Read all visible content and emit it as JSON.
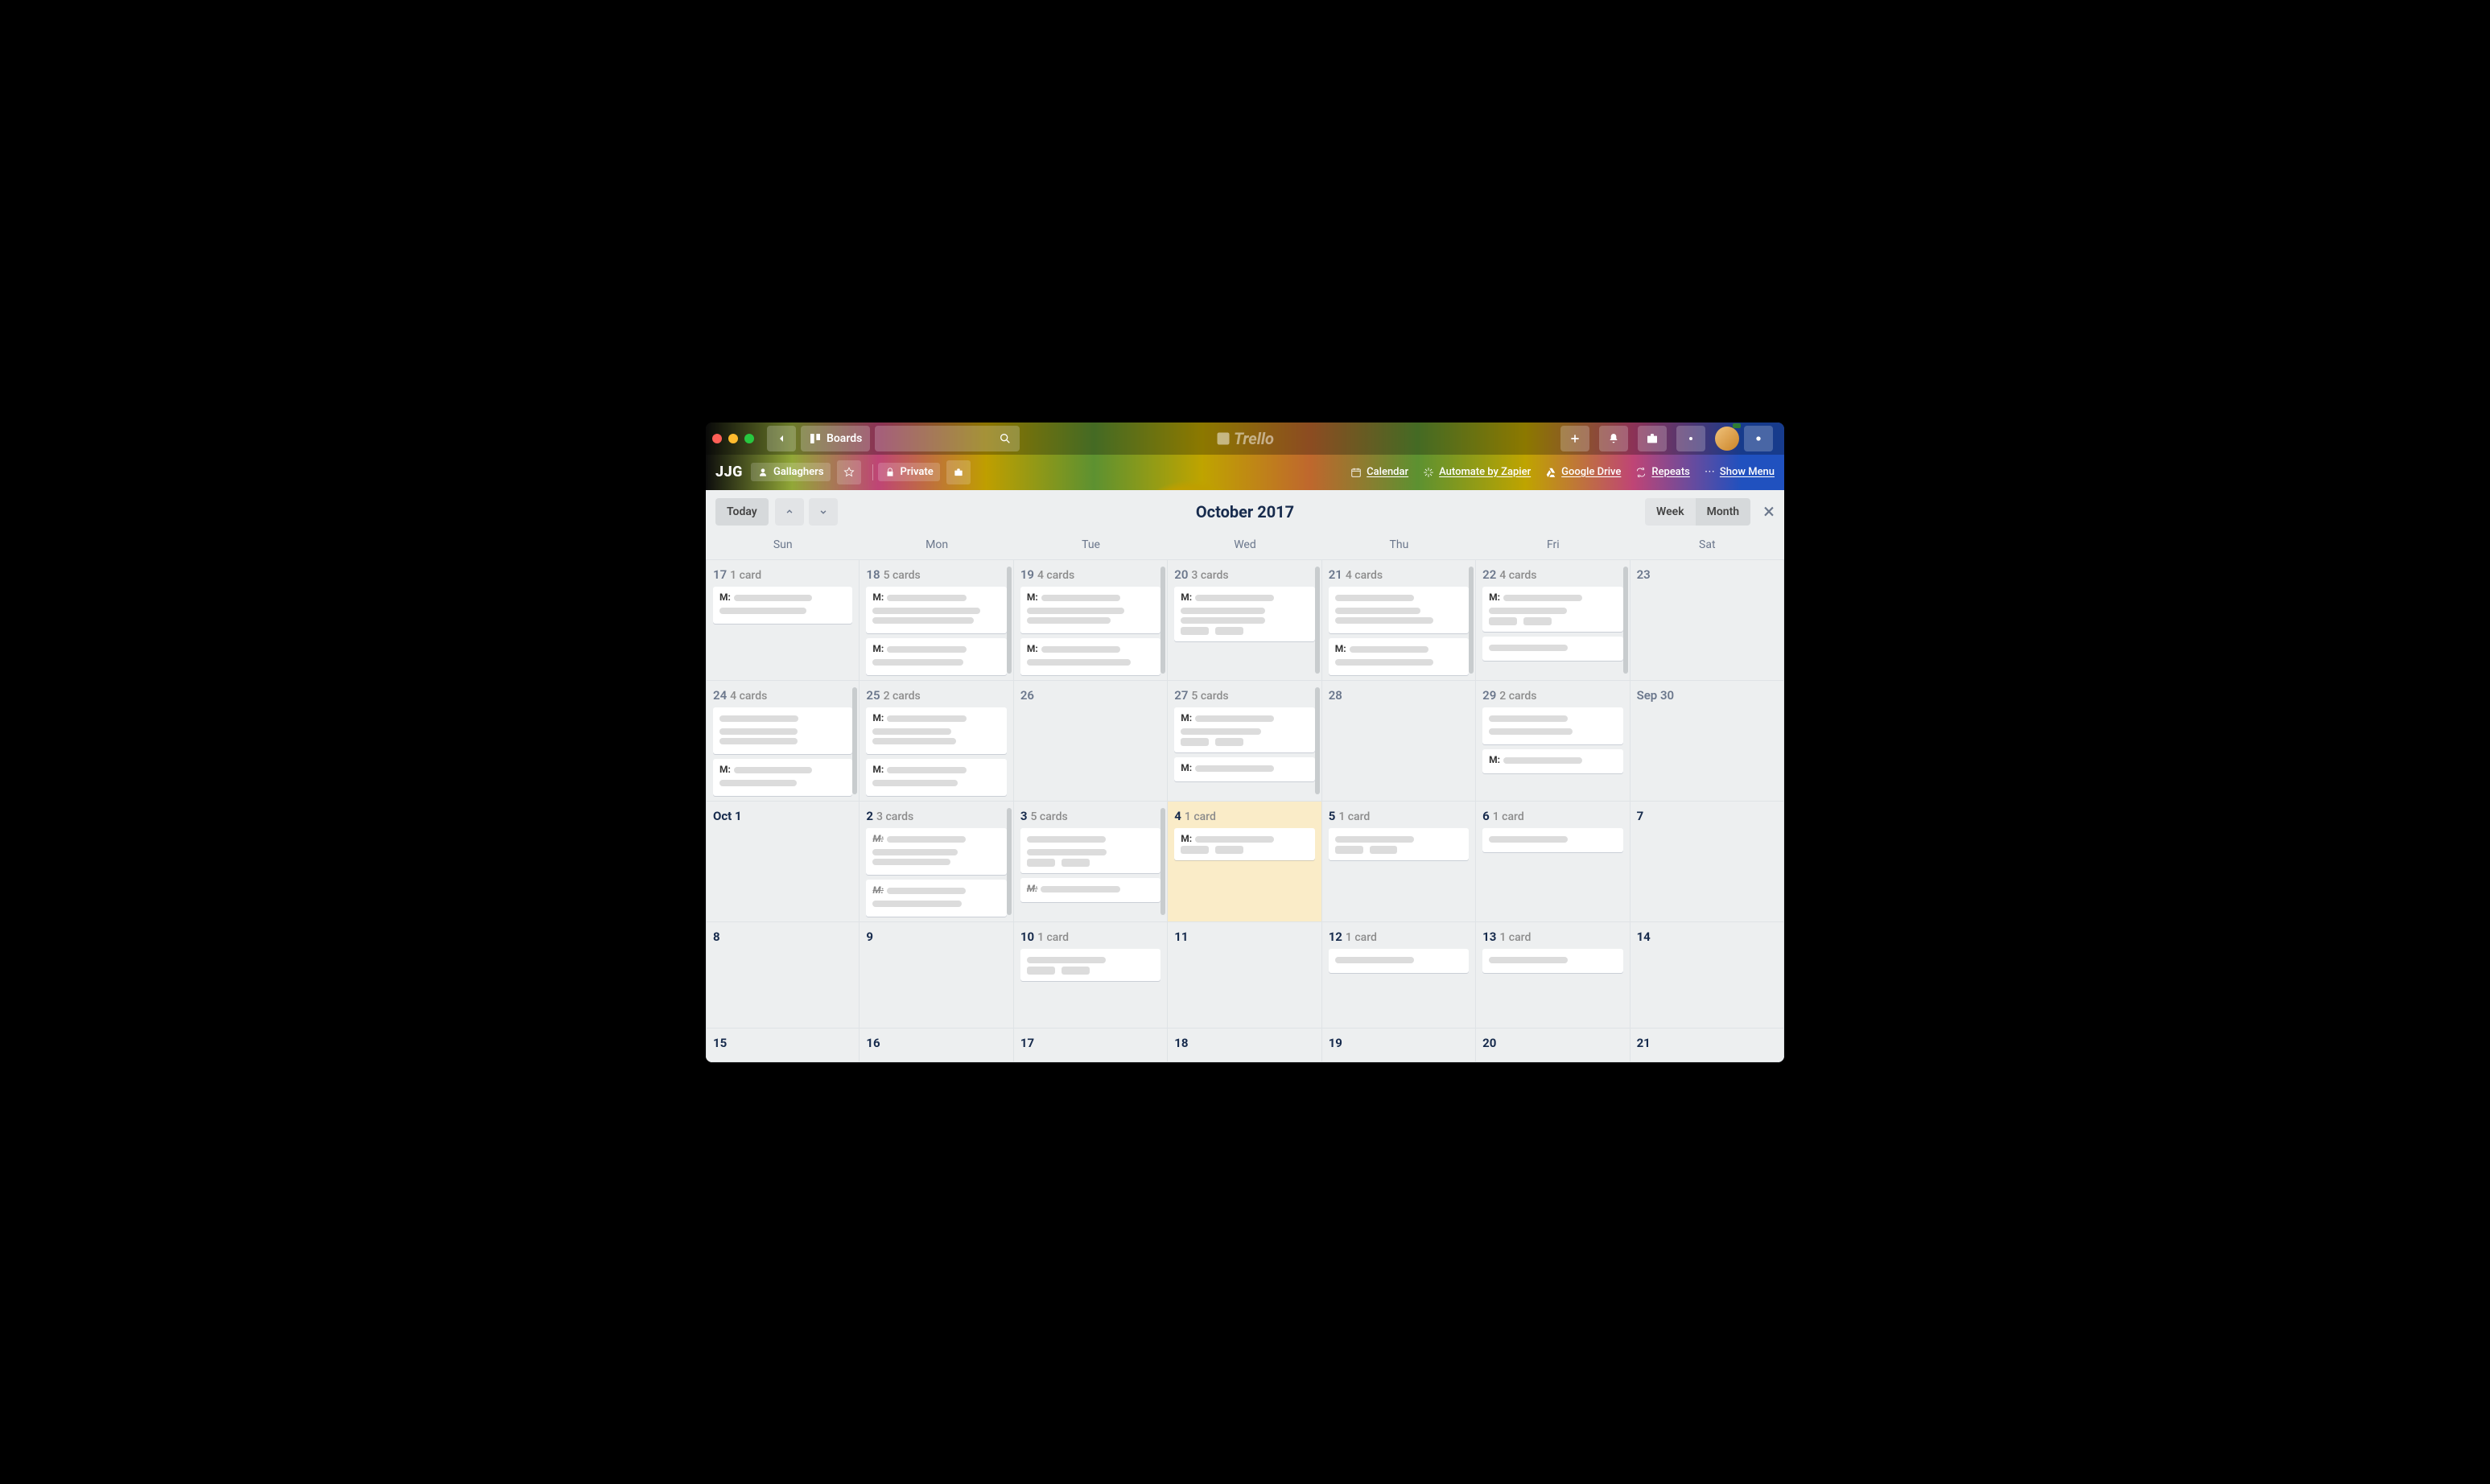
{
  "topbar": {
    "boards_label": "Boards",
    "logo_text": "Trello"
  },
  "board": {
    "title": "JJG",
    "team": "Gallaghers",
    "visibility": "Private",
    "powerups": [
      {
        "icon": "calendar",
        "label": "Calendar"
      },
      {
        "icon": "zap",
        "label": "Automate by Zapier"
      },
      {
        "icon": "gdrive",
        "label": "Google Drive"
      },
      {
        "icon": "repeat",
        "label": "Repeats"
      }
    ],
    "show_menu": "Show Menu"
  },
  "calendar": {
    "today_label": "Today",
    "title": "October 2017",
    "week_label": "Week",
    "month_label": "Month",
    "dow": [
      "Sun",
      "Mon",
      "Tue",
      "Wed",
      "Thu",
      "Fri",
      "Sat"
    ],
    "weeks": [
      [
        {
          "num": "17",
          "count": "1 card",
          "cards": [
            {
              "m": true
            }
          ],
          "dim": true
        },
        {
          "num": "18",
          "count": "5 cards",
          "cards": [
            {
              "m": true,
              "lines": 3
            },
            {
              "m": true
            }
          ],
          "dim": true,
          "scroll": true
        },
        {
          "num": "19",
          "count": "4 cards",
          "cards": [
            {
              "m": true,
              "lines": 3
            },
            {
              "m": true
            }
          ],
          "dim": true,
          "scroll": true
        },
        {
          "num": "20",
          "count": "3 cards",
          "cards": [
            {
              "m": true,
              "lines": 3,
              "badges": true
            }
          ],
          "dim": true,
          "scroll": true
        },
        {
          "num": "21",
          "count": "4 cards",
          "cards": [
            {
              "lines": 3
            },
            {
              "m": true
            }
          ],
          "dim": true,
          "scroll": true
        },
        {
          "num": "22",
          "count": "4 cards",
          "cards": [
            {
              "m": true,
              "lines": 2,
              "badges": true
            },
            {
              "lines": 1
            }
          ],
          "dim": true,
          "scroll": true
        },
        {
          "num": "23",
          "count": "",
          "cards": [],
          "dim": true
        }
      ],
      [
        {
          "num": "24",
          "count": "4 cards",
          "cards": [
            {
              "lines": 3
            },
            {
              "m": true
            }
          ],
          "dim": true,
          "scroll": true
        },
        {
          "num": "25",
          "count": "2 cards",
          "cards": [
            {
              "m": true,
              "lines": 3
            },
            {
              "m": true
            }
          ],
          "dim": true
        },
        {
          "num": "26",
          "count": "",
          "cards": [],
          "dim": true
        },
        {
          "num": "27",
          "count": "5 cards",
          "cards": [
            {
              "m": true,
              "lines": 2,
              "badges": true
            },
            {
              "m": true,
              "lines": 1
            }
          ],
          "dim": true,
          "scroll": true
        },
        {
          "num": "28",
          "count": "",
          "cards": [],
          "dim": true
        },
        {
          "num": "29",
          "count": "2 cards",
          "cards": [
            {
              "lines": 2
            },
            {
              "m": true,
              "lines": 1
            }
          ],
          "dim": true
        },
        {
          "num": "Sep 30",
          "count": "",
          "cards": [],
          "dim": true
        }
      ],
      [
        {
          "num": "Oct 1",
          "count": "",
          "cards": []
        },
        {
          "num": "2",
          "count": "3 cards",
          "cards": [
            {
              "m": true,
              "done": true,
              "lines": 3
            },
            {
              "m": true,
              "done": true
            }
          ],
          "scroll": true
        },
        {
          "num": "3",
          "count": "5 cards",
          "cards": [
            {
              "lines": 2,
              "badges": true
            },
            {
              "m": true,
              "done": true,
              "lines": 1
            }
          ],
          "scroll": true
        },
        {
          "num": "4",
          "count": "1 card",
          "today": true,
          "cards": [
            {
              "m": true,
              "lines": 1,
              "badges": true
            }
          ]
        },
        {
          "num": "5",
          "count": "1 card",
          "cards": [
            {
              "lines": 1,
              "badges": true
            }
          ]
        },
        {
          "num": "6",
          "count": "1 card",
          "cards": [
            {
              "lines": 1
            }
          ]
        },
        {
          "num": "7",
          "count": "",
          "cards": []
        }
      ],
      [
        {
          "num": "8",
          "count": "",
          "cards": []
        },
        {
          "num": "9",
          "count": "",
          "cards": []
        },
        {
          "num": "10",
          "count": "1 card",
          "cards": [
            {
              "lines": 1,
              "badges": true
            }
          ]
        },
        {
          "num": "11",
          "count": "",
          "cards": []
        },
        {
          "num": "12",
          "count": "1 card",
          "cards": [
            {
              "lines": 1
            }
          ]
        },
        {
          "num": "13",
          "count": "1 card",
          "cards": [
            {
              "lines": 1
            }
          ]
        },
        {
          "num": "14",
          "count": "",
          "cards": []
        }
      ],
      [
        {
          "num": "15",
          "count": "",
          "cards": [],
          "short": true
        },
        {
          "num": "16",
          "count": "",
          "cards": [],
          "short": true
        },
        {
          "num": "17",
          "count": "",
          "cards": [],
          "short": true
        },
        {
          "num": "18",
          "count": "",
          "cards": [],
          "short": true
        },
        {
          "num": "19",
          "count": "",
          "cards": [],
          "short": true
        },
        {
          "num": "20",
          "count": "",
          "cards": [],
          "short": true
        },
        {
          "num": "21",
          "count": "",
          "cards": [],
          "short": true
        }
      ]
    ]
  }
}
